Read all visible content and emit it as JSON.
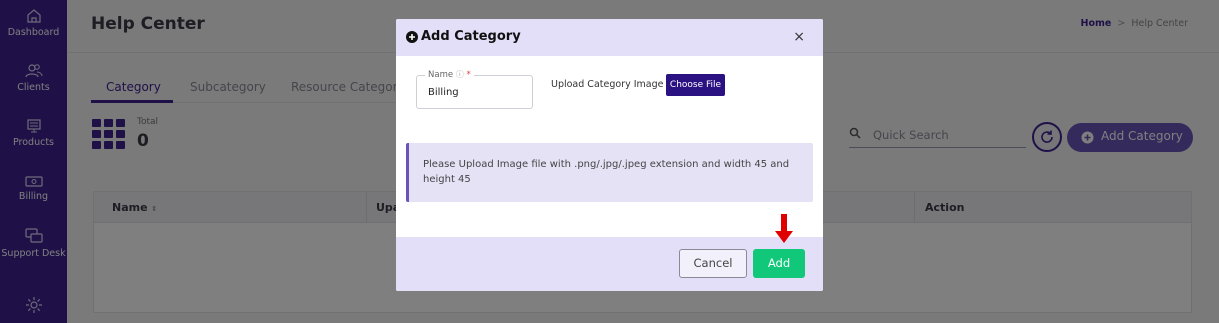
{
  "sidebar": {
    "items": [
      {
        "label": "Dashboard",
        "icon": "home-icon"
      },
      {
        "label": "Clients",
        "icon": "users-icon"
      },
      {
        "label": "Products",
        "icon": "products-icon"
      },
      {
        "label": "Billing",
        "icon": "billing-icon"
      },
      {
        "label": "Support Desk",
        "icon": "support-icon"
      },
      {
        "label": "",
        "icon": "gear-icon"
      }
    ]
  },
  "header": {
    "title": "Help Center",
    "breadcrumb_home": "Home",
    "breadcrumb_sep": ">",
    "breadcrumb_current": "Help Center"
  },
  "tabs": [
    "Category",
    "Subcategory",
    "Resource Category"
  ],
  "stats": {
    "total_label": "Total",
    "total_value": "0"
  },
  "search": {
    "placeholder": "Quick Search"
  },
  "toolbar": {
    "add_category_label": "Add Category"
  },
  "table": {
    "columns": [
      "Name",
      "Upa",
      "Action"
    ]
  },
  "modal": {
    "title": "Add Category",
    "close": "×",
    "name_label": "Name",
    "name_help": "?",
    "name_required": "*",
    "name_value": "Billing",
    "upload_label": "Upload Category Image",
    "choose_file_label": "Choose File",
    "info_text": "Please Upload Image file with .png/.jpg/.jpeg extension and width 45 and height 45",
    "cancel_label": "Cancel",
    "add_label": "Add"
  },
  "colors": {
    "sidebar": "#3f2390",
    "accent": "#6a54b8",
    "add_button": "#11c87a",
    "annotation_arrow": "#e00000"
  }
}
